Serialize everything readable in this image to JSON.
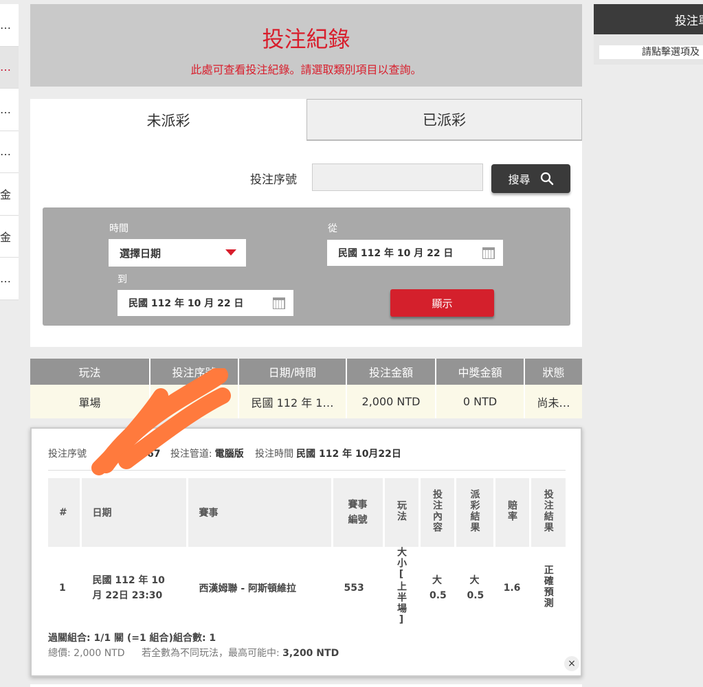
{
  "sidebar": {
    "items": [
      {
        "label": "…"
      },
      {
        "label": "…",
        "active": true
      },
      {
        "label": "…"
      },
      {
        "label": "…"
      },
      {
        "label": "金"
      },
      {
        "label": "金"
      },
      {
        "label": "…"
      }
    ]
  },
  "banner": {
    "title": "投注紀錄",
    "subtitle": "此處可查看投注紀錄。請選取類別項目以查詢。"
  },
  "right_panel": {
    "header": "投注單",
    "hint": "請點擊選項及"
  },
  "tabs": [
    {
      "label": "未派彩",
      "active": true
    },
    {
      "label": "已派彩",
      "active": false
    }
  ],
  "search": {
    "serial_label": "投注序號",
    "serial_value": "",
    "button_label": "搜尋"
  },
  "filter": {
    "time_label": "時間",
    "time_select": "選擇日期",
    "from_label": "從",
    "from_date": "民國 112 年 10 月 22 日",
    "to_label": "到",
    "to_date": "民國 112 年 10 月 22 日",
    "show_button": "顯示"
  },
  "results": {
    "headers": [
      "玩法",
      "投注序號",
      "日期/時間",
      "投注金額",
      "中獎金額",
      "狀態"
    ],
    "rows": [
      [
        "單場",
        "",
        "民國 112 年 1…",
        "2,000 NTD",
        "0 NTD",
        "尚未…"
      ]
    ]
  },
  "detail": {
    "serial_label": "投注序號",
    "serial_value": "67",
    "channel_label": "投注管道:",
    "channel_value": "電腦版",
    "time_label": "投注時間",
    "time_value": "民國 112 年 10月22日",
    "headers": [
      "#",
      "日期",
      "賽事",
      "賽事編號",
      "玩法",
      "投注內容",
      "派彩結果",
      "賠率",
      "投注結果"
    ],
    "rows": [
      [
        "1",
        "民國 112 年 10月 22日 23:30",
        "西漢姆聯 - 阿斯頓維拉",
        "553",
        "大小[上半場]",
        "大 0.5",
        "大 0.5",
        "1.6",
        "正確預測"
      ]
    ],
    "combo": "過關組合: 1/1 關 (=1 組合)組合數: 1",
    "total_label": "總價:",
    "total_value": "2,000 NTD",
    "max_label": "若全數為不同玩法，最高可能中:",
    "max_value": "3,200 NTD",
    "close": "×"
  },
  "colors": {
    "accent_red": "#d81e2c",
    "header_gray": "#949494",
    "dark_button": "#3a3a3a",
    "scribble": "#ff7a3d"
  }
}
